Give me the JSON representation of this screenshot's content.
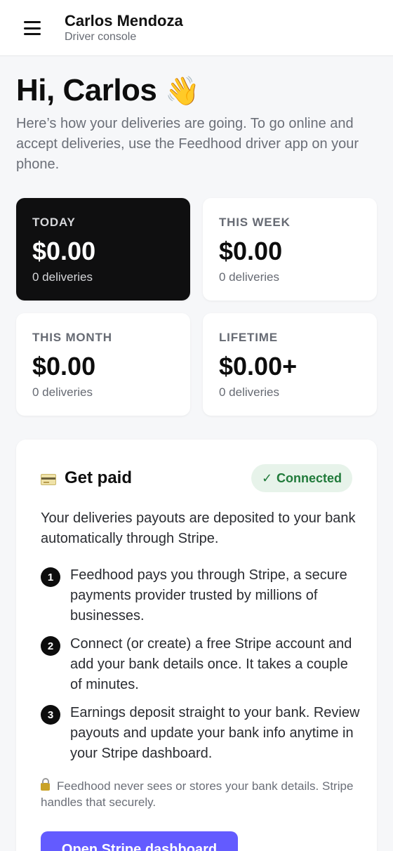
{
  "header": {
    "name": "Carlos Mendoza",
    "subtitle": "Driver console"
  },
  "greeting": {
    "title": "Hi, Carlos",
    "emoji": "👋",
    "intro": "Here’s how your deliveries are going. To go online and accept deliveries, use the Feedhood driver app on your phone."
  },
  "stats": [
    {
      "label": "TODAY",
      "amount": "$0.00",
      "count": "0 deliveries"
    },
    {
      "label": "THIS WEEK",
      "amount": "$0.00",
      "count": "0 deliveries"
    },
    {
      "label": "THIS MONTH",
      "amount": "$0.00",
      "count": "0 deliveries"
    },
    {
      "label": "LIFETIME",
      "amount": "$0.00+",
      "count": "0 deliveries"
    }
  ],
  "payout": {
    "title": "Get paid",
    "icon": "credit-card-icon",
    "status": "Connected",
    "status_check": "✓",
    "description": "Your deliveries payouts are deposited to your bank automatically through Stripe.",
    "steps": [
      {
        "num": "1",
        "text": "Feedhood pays you through Stripe, a secure payments provider trusted by millions of businesses."
      },
      {
        "num": "2",
        "text": "Connect (or create) a free Stripe account and add your bank details once. It takes a couple of minutes."
      },
      {
        "num": "3",
        "text": "Earnings deposit straight to your bank. Review payouts and update your bank info anytime in your Stripe dashboard."
      }
    ],
    "note": "Feedhood never sees or stores your bank details. Stripe handles that securely.",
    "button": "Open Stripe dashboard"
  },
  "colors": {
    "accent": "#635bff",
    "success_bg": "#e7f3ea",
    "success_text": "#207a3a",
    "dark_card": "#0f0f10"
  }
}
